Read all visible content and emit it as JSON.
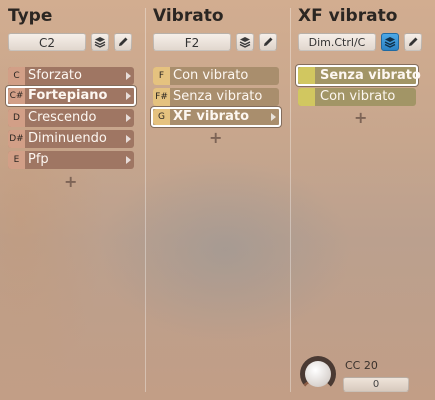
{
  "type_panel": {
    "title": "Type",
    "select_value": "C2",
    "add_symbol": "+",
    "items": [
      {
        "key": "C",
        "label": "Sforzato",
        "selected": false
      },
      {
        "key": "C#",
        "label": "Fortepiano",
        "selected": true
      },
      {
        "key": "D",
        "label": "Crescendo",
        "selected": false
      },
      {
        "key": "D#",
        "label": "Diminuendo",
        "selected": false
      },
      {
        "key": "E",
        "label": "Pfp",
        "selected": false
      }
    ]
  },
  "vibrato_panel": {
    "title": "Vibrato",
    "select_value": "F2",
    "add_symbol": "+",
    "items": [
      {
        "key": "F",
        "label": "Con vibrato",
        "selected": false
      },
      {
        "key": "F#",
        "label": "Senza vibrato",
        "selected": false
      },
      {
        "key": "G",
        "label": "XF vibrato",
        "selected": true
      }
    ]
  },
  "xf_panel": {
    "title": "XF vibrato",
    "select_value": "Dim.Ctrl/C",
    "add_symbol": "+",
    "items": [
      {
        "label": "Senza vibrato",
        "selected": true
      },
      {
        "label": "Con vibrato",
        "selected": false
      }
    ],
    "cc_label": "CC 20",
    "cc_value": "0"
  },
  "icons": {
    "layers": "layers-icon",
    "edit": "pencil-icon"
  },
  "colors": {
    "layers_active": "#3a94d8"
  }
}
